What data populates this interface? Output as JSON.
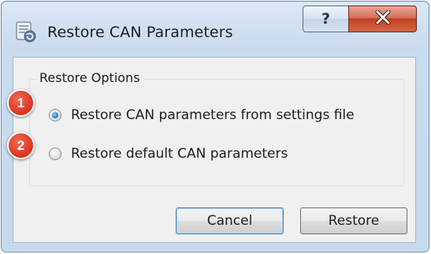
{
  "window": {
    "title": "Restore CAN Parameters",
    "help_glyph": "?",
    "icon": "restore-parameters-icon"
  },
  "group": {
    "label": "Restore Options",
    "options": [
      {
        "badge": "1",
        "label": "Restore CAN parameters from settings file",
        "selected": true
      },
      {
        "badge": "2",
        "label": "Restore default CAN parameters",
        "selected": false
      }
    ]
  },
  "buttons": {
    "cancel": "Cancel",
    "restore": "Restore"
  },
  "colors": {
    "badge": "#de3a25",
    "close_button": "#c23f21",
    "radio_selected": "#2b7cc4"
  }
}
